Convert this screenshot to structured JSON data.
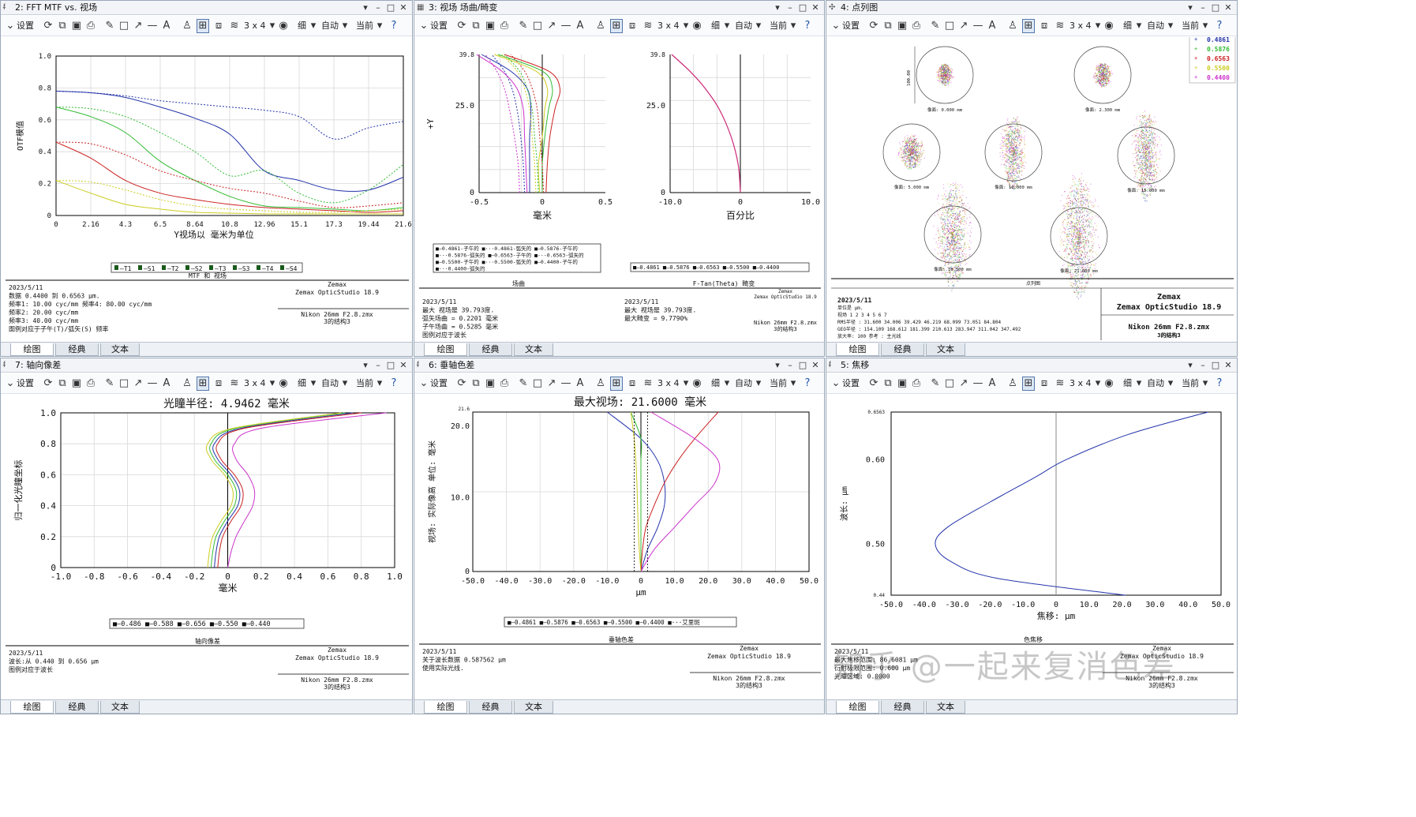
{
  "toolbar": {
    "settings": "设置",
    "grid": "3 x 4",
    "thin": "细",
    "auto": "自动",
    "current": "当前"
  },
  "tabs": {
    "plot": "绘图",
    "classic": "经典",
    "text": "文本"
  },
  "windows": {
    "mtf": {
      "title": "2: FFT MTF vs. 视场",
      "ylabel": "OTF模值",
      "xlabel": "Y视场以 毫米为单位",
      "plot_title": "MTF 和 视场",
      "legend": [
        "T1",
        "S1",
        "T2",
        "S2",
        "T3",
        "S3",
        "T4",
        "S4"
      ],
      "info_left": "2023/5/11\n数据 0.4400 到 0.6563 μm.\n频率1:   10.00 cyc/mm      频率4:   80.00 cyc/mm\n频率2:   20.00 cyc/mm\n频率3:   40.00 cyc/mm\n图例对应于子午(T)/弧矢(S) 频率",
      "info_right_top": "Zemax\nZemax OpticStudio 18.9",
      "info_right_bottom": "Nikon 26mm F2.8.zmx\n3的结构3"
    },
    "field": {
      "title": "3: 视场 场曲/畸变",
      "ylabel": "+Y",
      "xlabel1": "毫米",
      "xlabel2": "百分比",
      "plot_title1": "场曲",
      "plot_title2": "F-Tan(Theta) 畸变",
      "legend1": "■—0.4861-子午的 ■···0.4861-弧矢的 ■—0.5876-子午的\n■···0.5876-弧矢的 ■—0.6563-子午的 ■···0.6563-弧矢的\n■—0.5500-子午的 ■···0.5500-弧矢的 ■—0.4400-子午的\n■···0.4400-弧矢的",
      "legend2": "■—0.4861 ■—0.5876 ■—0.6563 ■—0.5500 ■—0.4400",
      "info_left1": "2023/5/11\n最大 视场是 39.793度.\n弧矢场曲 = 0.2201 毫米\n子午场曲 = 0.5285 毫米\n图例对应于波长",
      "info_left2": "2023/5/11\n最大 视场是 39.793度.\n最大畸变 = 9.7790%",
      "info_right_top": "Zemax\nZemax OpticStudio 18.9",
      "info_right_bottom": "Nikon 26mm F2.8.zmx\n3的结构3"
    },
    "spot": {
      "title": "4: 点列图",
      "legend": [
        "0.4861",
        "0.5876",
        "0.6563",
        "0.5500",
        "0.4400"
      ],
      "plot_title": "点列图",
      "scale": "100.00",
      "spot_labels": [
        "像面: 0.000 mm",
        "像面: 2.300 mm",
        "像面: 5.000 mm",
        "像面: 10.000 mm",
        "像面: 15.000 mm",
        "像面: 18.500 mm",
        "像面: 21.600 mm"
      ],
      "info": "2023/5/11\n单位是 μm.\n视场       1        2        3        4        5        6        7\nRMS半径 :   31.600   34.006   39.429   46.219   68.099   73.051   84.804\nGEO半径 :  154.109  168.612  181.399  210.613  283.947  311.042  347.492\n放大率:   100      参考 : 主光线",
      "info_right_top": "Zemax\nZemax OpticStudio 18.9",
      "info_right_bottom": "Nikon 26mm F2.8.zmx\n3的结构3"
    },
    "axial": {
      "title": "7: 轴向像差",
      "heading": "光瞳半径: 4.9462 毫米",
      "ylabel": "归一化光瞳坐标",
      "xlabel": "毫米",
      "plot_title": "轴向像差",
      "legend": "■—0.486 ■—0.588 ■—0.656 ■—0.550 ■—0.440",
      "info_left": "2023/5/11\n波长:从 0.440 到 0.656 μm\n图例对应于波长",
      "info_right_top": "Zemax\nZemax OpticStudio 18.9",
      "info_right_bottom": "Nikon 26mm F2.8.zmx\n3的结构3"
    },
    "lateral": {
      "title": "6: 垂轴色差",
      "heading": "最大视场: 21.6000 毫米",
      "ylabel": "视场: 实际像高 单位: 毫米",
      "xlabel": "μm",
      "plot_title": "垂轴色差",
      "legend": "■—0.4861 ■—0.5876 ■—0.6563 ■—0.5500 ■—0.4400 ■···艾里斑",
      "info_left": "2023/5/11\n关于波长数据 0.587562 μm\n使用实际光线.",
      "info_right_top": "Zemax\nZemax OpticStudio 18.9",
      "info_right_bottom": "Nikon 26mm F2.8.zmx\n3的结构3"
    },
    "focal": {
      "title": "5: 焦移",
      "ylabel": "波长: μm",
      "xlabel": "焦移: μm",
      "plot_title": "色焦移",
      "info_left": "2023/5/11\n最大焦移范围: 86.6081 μm\n衍射极限范围:  0.600 μm\n光瞳区域: 0.0000",
      "info_right_top": "Zemax\nZemax OpticStudio 18.9",
      "info_right_bottom": "Nikon 26mm F2.8.zmx\n3的结构3"
    }
  },
  "watermark": "知乎 @一起来复消色差",
  "colors": {
    "blue": "#2233aa",
    "green": "#33bb33",
    "red": "#cc2222",
    "yellow": "#cccc22",
    "magenta": "#cc33cc"
  },
  "chart_data": [
    {
      "type": "line",
      "title": "MTF 和 视场",
      "xlabel": "Y视场以 毫米为单位",
      "ylabel": "OTF模值",
      "xlim": [
        0,
        21.6
      ],
      "ylim": [
        0,
        1.0
      ],
      "xticks": [
        "0",
        "2.16",
        "4.3",
        "6.5",
        "8.64",
        "10.8",
        "12.96",
        "15.1",
        "17.3",
        "19.44",
        "21.6"
      ],
      "yticks": [
        "0",
        "0.2",
        "0.4",
        "0.6",
        "0.8",
        "1.0"
      ],
      "x": [
        0,
        2.16,
        4.32,
        6.48,
        8.64,
        10.8,
        12.96,
        15.12,
        17.28,
        19.44,
        21.6
      ],
      "series": [
        {
          "name": "T1",
          "color": "#2233aa",
          "dash": false,
          "values": [
            0.78,
            0.77,
            0.74,
            0.68,
            0.61,
            0.51,
            0.28,
            0.22,
            0.16,
            0.16,
            0.24
          ]
        },
        {
          "name": "S1",
          "color": "#2233aa",
          "dash": true,
          "values": [
            0.78,
            0.77,
            0.75,
            0.72,
            0.7,
            0.68,
            0.66,
            0.62,
            0.48,
            0.55,
            0.59
          ]
        },
        {
          "name": "T2",
          "color": "#33bb33",
          "dash": false,
          "values": [
            0.68,
            0.62,
            0.52,
            0.34,
            0.22,
            0.12,
            0.06,
            0.05,
            0.04,
            0.03,
            0.05
          ]
        },
        {
          "name": "S2",
          "color": "#33bb33",
          "dash": true,
          "values": [
            0.68,
            0.67,
            0.62,
            0.52,
            0.4,
            0.25,
            0.28,
            0.14,
            0.08,
            0.16,
            0.32
          ]
        },
        {
          "name": "T3",
          "color": "#cc2222",
          "dash": false,
          "values": [
            0.46,
            0.36,
            0.22,
            0.14,
            0.1,
            0.07,
            0.05,
            0.04,
            0.03,
            0.02,
            0.03
          ]
        },
        {
          "name": "S3",
          "color": "#cc2222",
          "dash": true,
          "values": [
            0.46,
            0.45,
            0.38,
            0.28,
            0.22,
            0.17,
            0.14,
            0.09,
            0.05,
            0.06,
            0.08
          ]
        },
        {
          "name": "T4",
          "color": "#cccc22",
          "dash": false,
          "values": [
            0.22,
            0.14,
            0.07,
            0.04,
            0.02,
            0.015,
            0.01,
            0.01,
            0.01,
            0.01,
            0.01
          ]
        },
        {
          "name": "S4",
          "color": "#cccc22",
          "dash": true,
          "values": [
            0.22,
            0.21,
            0.16,
            0.1,
            0.06,
            0.04,
            0.03,
            0.02,
            0.02,
            0.03,
            0.04
          ]
        }
      ]
    },
    {
      "type": "line",
      "title": "场曲",
      "xlabel": "毫米",
      "ylabel": "+Y",
      "xlim": [
        -0.5,
        0.5
      ],
      "ylim": [
        0,
        39.8
      ],
      "xticks": [
        "-0.5",
        "0",
        "0.5"
      ],
      "yticks": [
        "0",
        "25.0",
        "39.8"
      ],
      "y": [
        0,
        8,
        16,
        24,
        30,
        35,
        39.8
      ],
      "series": [
        {
          "name": "0.4861-子午的",
          "color": "#2233aa",
          "dash": false,
          "values": [
            -0.1,
            -0.1,
            -0.1,
            -0.09,
            -0.12,
            -0.25,
            -0.48
          ]
        },
        {
          "name": "0.4861-弧矢的",
          "color": "#2233aa",
          "dash": true,
          "values": [
            -0.14,
            -0.15,
            -0.17,
            -0.2,
            -0.24,
            -0.3,
            -0.4
          ]
        },
        {
          "name": "0.5876-子午的",
          "color": "#33bb33",
          "dash": false,
          "values": [
            0.0,
            0.0,
            0.02,
            0.05,
            0.08,
            0.0,
            -0.35
          ]
        },
        {
          "name": "0.5876-弧矢的",
          "color": "#33bb33",
          "dash": true,
          "values": [
            -0.03,
            -0.04,
            -0.06,
            -0.08,
            -0.12,
            -0.18,
            -0.3
          ]
        },
        {
          "name": "0.6563-子午的",
          "color": "#cc2222",
          "dash": false,
          "values": [
            0.03,
            0.04,
            0.06,
            0.1,
            0.14,
            0.05,
            -0.3
          ]
        },
        {
          "name": "0.6563-弧矢的",
          "color": "#cc2222",
          "dash": true,
          "values": [
            0.01,
            0.0,
            -0.02,
            -0.04,
            -0.08,
            -0.14,
            -0.25
          ]
        },
        {
          "name": "0.5500-子午的",
          "color": "#cccc22",
          "dash": false,
          "values": [
            -0.02,
            -0.03,
            0.0,
            0.02,
            0.04,
            -0.05,
            -0.38
          ]
        },
        {
          "name": "0.5500-弧矢的",
          "color": "#cccc22",
          "dash": true,
          "values": [
            -0.05,
            -0.06,
            -0.08,
            -0.1,
            -0.14,
            -0.2,
            -0.32
          ]
        },
        {
          "name": "0.4400-子午的",
          "color": "#cc33cc",
          "dash": false,
          "values": [
            -0.12,
            -0.13,
            -0.14,
            -0.15,
            -0.2,
            -0.32,
            -0.52
          ]
        },
        {
          "name": "0.4400-弧矢的",
          "color": "#cc33cc",
          "dash": true,
          "values": [
            -0.18,
            -0.19,
            -0.22,
            -0.26,
            -0.3,
            -0.36,
            -0.45
          ]
        }
      ]
    },
    {
      "type": "line",
      "title": "F-Tan(Theta) 畸变",
      "xlabel": "百分比",
      "ylabel": "",
      "xlim": [
        -10,
        10
      ],
      "ylim": [
        0,
        39.8
      ],
      "xticks": [
        "-10.0",
        "0",
        "10.0"
      ],
      "yticks": [
        "0",
        "25.0",
        "39.8"
      ],
      "y": [
        0,
        8,
        16,
        24,
        30,
        35,
        39.8
      ],
      "series": [
        {
          "name": "0.4861",
          "color": "#cc2222",
          "dash": false,
          "values": [
            0,
            -0.3,
            -1.3,
            -3.0,
            -5.0,
            -7.2,
            -9.78
          ]
        }
      ]
    },
    {
      "type": "line",
      "title": "光瞳半径: 4.9462 毫米",
      "xlabel": "毫米",
      "ylabel": "归一化光瞳坐标",
      "xlim": [
        -1.0,
        1.0
      ],
      "ylim": [
        0,
        1.0
      ],
      "xticks": [
        "-1.0",
        "-0.8",
        "-0.6",
        "-0.4",
        "-0.2",
        "0",
        "0.2",
        "0.4",
        "0.6",
        "0.8",
        "1.0"
      ],
      "yticks": [
        "0",
        "0.2",
        "0.4",
        "0.6",
        "0.8",
        "1.0"
      ],
      "y": [
        0,
        0.1,
        0.2,
        0.3,
        0.4,
        0.5,
        0.6,
        0.7,
        0.8,
        0.9,
        1.0
      ],
      "series": [
        {
          "name": "0.486",
          "color": "#2233aa",
          "dash": false,
          "values": [
            -0.08,
            -0.07,
            -0.05,
            0.0,
            0.06,
            0.07,
            0.02,
            -0.06,
            -0.08,
            0.08,
            0.75
          ]
        },
        {
          "name": "0.588",
          "color": "#33bb33",
          "dash": false,
          "values": [
            -0.1,
            -0.09,
            -0.07,
            -0.02,
            0.04,
            0.05,
            0.0,
            -0.08,
            -0.1,
            0.05,
            0.7
          ]
        },
        {
          "name": "0.656",
          "color": "#cc2222",
          "dash": false,
          "values": [
            -0.06,
            -0.05,
            -0.03,
            0.02,
            0.08,
            0.09,
            0.04,
            -0.04,
            -0.06,
            0.1,
            0.8
          ]
        },
        {
          "name": "0.550",
          "color": "#cccc22",
          "dash": false,
          "values": [
            -0.12,
            -0.11,
            -0.09,
            -0.04,
            0.02,
            0.03,
            -0.02,
            -0.1,
            -0.12,
            0.03,
            0.68
          ]
        },
        {
          "name": "0.440",
          "color": "#cc33cc",
          "dash": false,
          "values": [
            0.0,
            0.02,
            0.05,
            0.1,
            0.15,
            0.16,
            0.12,
            0.05,
            0.04,
            0.2,
            0.95
          ]
        }
      ]
    },
    {
      "type": "line",
      "title": "最大视场: 21.6000 毫米",
      "xlabel": "μm",
      "ylabel": "视场: 实际像高 单位: 毫米",
      "xlim": [
        -50,
        50
      ],
      "ylim": [
        0,
        21.6
      ],
      "xticks": [
        "-50.0",
        "-40.0",
        "-30.0",
        "-20.0",
        "-10.0",
        "0",
        "10.0",
        "20.0",
        "30.0",
        "40.0",
        "50.0"
      ],
      "yticks": [
        "0",
        "10.0",
        "20.0",
        "21.6"
      ],
      "y": [
        0,
        3,
        6,
        9,
        12,
        15,
        18,
        21.6
      ],
      "series": [
        {
          "name": "0.4861",
          "color": "#2233aa",
          "dash": false,
          "values": [
            0,
            2,
            5,
            7,
            7,
            5,
            0,
            -10
          ]
        },
        {
          "name": "0.5876",
          "color": "#33bb33",
          "dash": false,
          "values": [
            0,
            0,
            0,
            0,
            0,
            0,
            0,
            -3
          ]
        },
        {
          "name": "0.6563",
          "color": "#cc2222",
          "dash": false,
          "values": [
            0,
            0.5,
            1.5,
            4,
            7,
            11,
            16,
            23
          ]
        },
        {
          "name": "0.5500",
          "color": "#cccc22",
          "dash": false,
          "values": [
            0,
            -0.5,
            -0.8,
            -1,
            -1.2,
            -1.5,
            -2,
            -3
          ]
        },
        {
          "name": "0.4400",
          "color": "#cc33cc",
          "dash": false,
          "values": [
            0,
            4,
            10,
            16,
            22,
            23,
            16,
            3
          ]
        },
        {
          "name": "艾里斑",
          "color": "#000000",
          "dash": true,
          "values": [
            2,
            2,
            2,
            2,
            2,
            2,
            2,
            2
          ]
        }
      ]
    },
    {
      "type": "line",
      "title": "色焦移",
      "xlabel": "焦移: μm",
      "ylabel": "波长: μm",
      "xlim": [
        -50,
        50
      ],
      "ylim": [
        0.44,
        0.6563
      ],
      "xticks": [
        "-50.0",
        "-40.0",
        "-30.0",
        "-20.0",
        "-10.0",
        "0",
        "10.0",
        "20.0",
        "30.0",
        "40.0",
        "50.0"
      ],
      "yticks": [
        "0.44",
        "0.50",
        "0.60",
        "0.6563"
      ],
      "y": [
        0.44,
        0.46,
        0.48,
        0.5,
        0.52,
        0.55,
        0.58,
        0.6,
        0.63,
        0.6563
      ],
      "series": [
        {
          "name": "焦移",
          "color": "#2233aa",
          "dash": false,
          "values": [
            21,
            -18,
            -32,
            -36.6,
            -33,
            -20,
            -6,
            3,
            22,
            46
          ]
        }
      ]
    }
  ]
}
